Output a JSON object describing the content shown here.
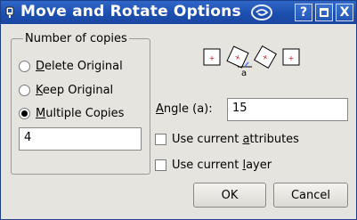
{
  "window": {
    "title": "Move and Rotate Options"
  },
  "titlebar": {
    "help_label": "?",
    "maximize_icon": "maximize-icon",
    "close_label": "X"
  },
  "copies_group": {
    "legend": "Number of copies",
    "options": [
      {
        "label": "Delete Original",
        "selected": false
      },
      {
        "label": "Keep Original",
        "selected": false
      },
      {
        "label": "Multiple Copies",
        "selected": true
      }
    ],
    "count_value": "4"
  },
  "preview": {
    "angle_marker": "a"
  },
  "angle": {
    "label": "Angle (a):",
    "value": "15"
  },
  "checkboxes": [
    {
      "label_before": "Use current ",
      "label_accel": "a",
      "label_after": "ttributes",
      "checked": false
    },
    {
      "label_before": "Use current ",
      "label_accel": "l",
      "label_after": "ayer",
      "checked": false
    }
  ],
  "buttons": {
    "ok": "OK",
    "cancel": "Cancel"
  },
  "colors": {
    "titlebar": "#1d4fb0",
    "marker": "#d01010"
  }
}
